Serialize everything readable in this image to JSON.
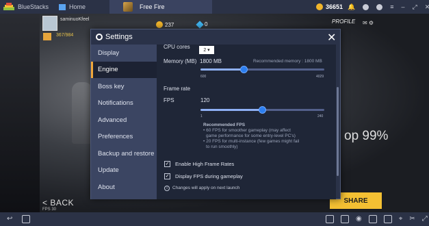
{
  "titlebar": {
    "app_name": "BlueStacks",
    "tab_home": "Home",
    "tab_game": "Free Fire",
    "coins": "36651"
  },
  "game": {
    "player_name": "saminuoKfeel",
    "player_level": "367/984",
    "coin_amount": "237",
    "diamond_amount": "0",
    "profile_label": "PROFILE",
    "back_label": "BACK",
    "fps_label": "FPS 30",
    "promo_text": "op 99%",
    "share_label": "SHARE"
  },
  "settings": {
    "title": "Settings",
    "nav": [
      "Display",
      "Engine",
      "Boss key",
      "Notifications",
      "Advanced",
      "Preferences",
      "Backup and restore",
      "Update",
      "About"
    ],
    "active_nav": 1,
    "cpu_label": "CPU cores",
    "cpu_value": "2",
    "memory_label": "Memory (MB)",
    "memory_value": "1800 MB",
    "memory_recommended": "Recommended memory : 1800 MB",
    "memory_min": "600",
    "memory_max": "4029",
    "memory_current": 1800,
    "frame_rate_heading": "Frame rate",
    "fps_label": "FPS",
    "fps_value": "120",
    "fps_min": "1",
    "fps_max": "240",
    "fps_current": 120,
    "recommended_heading": "Recommended FPS",
    "recommended_lines": [
      "• 60 FPS for smoother gameplay (may affect",
      "game performance for some entry-level PC's)",
      "• 20 FPS for multi-instance (few games might fail",
      "to run smoothly)"
    ],
    "high_fps_label": "Enable High Frame Rates",
    "high_fps_checked": true,
    "display_fps_label": "Display FPS during gameplay",
    "display_fps_checked": true,
    "note": "Changes will apply on next launch"
  },
  "colors": {
    "accent": "#f0a73a",
    "slider_thumb": "#2d7ff0",
    "dialog_bg": "#2a3248",
    "content_bg": "#1f2637"
  }
}
